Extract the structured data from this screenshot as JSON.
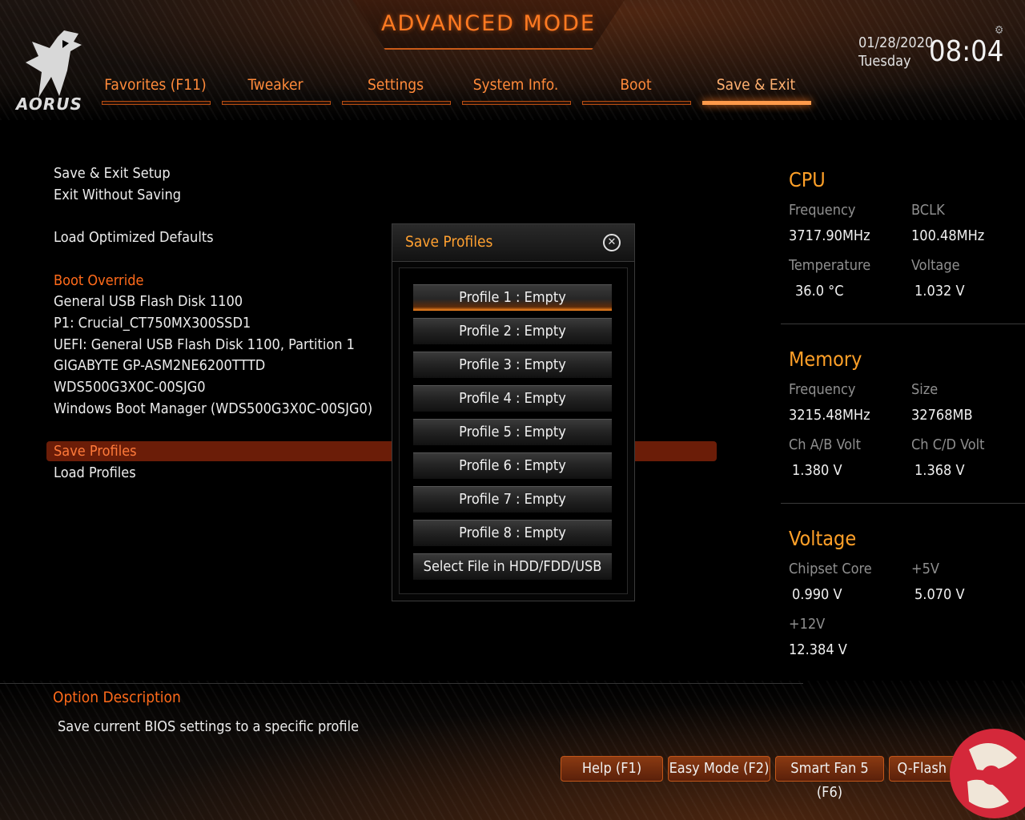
{
  "header": {
    "title": "ADVANCED MODE",
    "logo_text": "AORUS",
    "date": "01/28/2020",
    "day": "Tuesday",
    "time": "08:04"
  },
  "tabs": [
    {
      "label": "Favorites (F11)",
      "active": false
    },
    {
      "label": "Tweaker",
      "active": false
    },
    {
      "label": "Settings",
      "active": false
    },
    {
      "label": "System Info.",
      "active": false
    },
    {
      "label": "Boot",
      "active": false
    },
    {
      "label": "Save & Exit",
      "active": true
    }
  ],
  "menu": {
    "save_exit_setup": "Save & Exit Setup",
    "exit_without_saving": "Exit Without Saving",
    "load_optimized_defaults": "Load Optimized Defaults",
    "boot_override_header": "Boot Override",
    "boot_devices": [
      "General USB Flash Disk 1100",
      "P1: Crucial_CT750MX300SSD1",
      "UEFI: General USB Flash Disk 1100, Partition 1",
      "GIGABYTE GP-ASM2NE6200TTTD",
      "WDS500G3X0C-00SJG0",
      "Windows Boot Manager (WDS500G3X0C-00SJG0)"
    ],
    "save_profiles": "Save Profiles",
    "load_profiles": "Load Profiles"
  },
  "dialog": {
    "title": "Save Profiles",
    "buttons": [
      "Profile 1 : Empty",
      "Profile 2 : Empty",
      "Profile 3 : Empty",
      "Profile 4 : Empty",
      "Profile 5 : Empty",
      "Profile 6 : Empty",
      "Profile 7 : Empty",
      "Profile 8 : Empty",
      "Select File in HDD/FDD/USB"
    ]
  },
  "cpu": {
    "heading": "CPU",
    "frequency_label": "Frequency",
    "frequency": "3717.90MHz",
    "bclk_label": "BCLK",
    "bclk": "100.48MHz",
    "temperature_label": "Temperature",
    "temperature": "36.0 °C",
    "voltage_label": "Voltage",
    "voltage": "1.032 V"
  },
  "memory": {
    "heading": "Memory",
    "frequency_label": "Frequency",
    "frequency": "3215.48MHz",
    "size_label": "Size",
    "size": "32768MB",
    "chab_label": "Ch A/B Volt",
    "chab": "1.380 V",
    "chcd_label": "Ch C/D Volt",
    "chcd": "1.368 V"
  },
  "voltage": {
    "heading": "Voltage",
    "chipset_label": "Chipset Core",
    "chipset": "0.990 V",
    "plus5_label": "+5V",
    "plus5": "5.070 V",
    "plus12_label": "+12V",
    "plus12": "12.384 V"
  },
  "description": {
    "heading": "Option Description",
    "text": "Save current BIOS settings to a specific profile"
  },
  "footer_buttons": [
    "Help (F1)",
    "Easy Mode (F2)",
    "Smart Fan 5 (F6)",
    "Q-Flash (F8)"
  ],
  "colors": {
    "accent": "#ff7a22",
    "highlight": "#6b1d08",
    "heading": "#ffa028"
  }
}
